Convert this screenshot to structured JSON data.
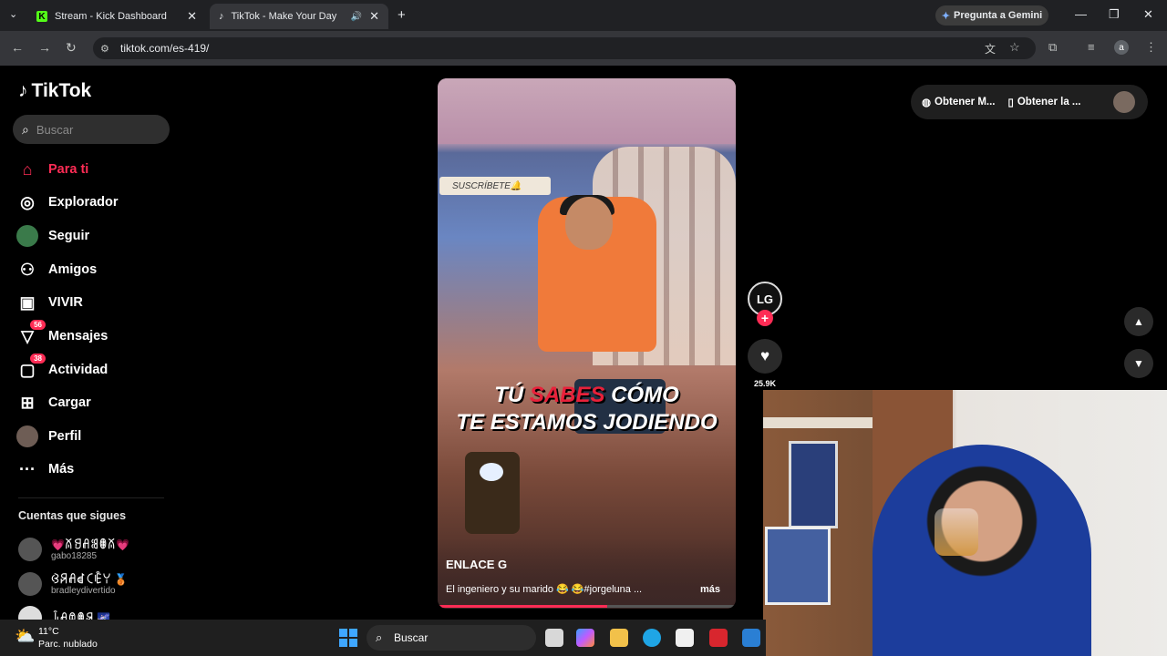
{
  "browser": {
    "tabs": [
      {
        "title": "Stream - Kick Dashboard",
        "favicon": "K"
      },
      {
        "title": "TikTok - Make Your Day",
        "favicon": "♪"
      }
    ],
    "url": "tiktok.com/es-419/",
    "gemini_label": "Pregunta a Gemini",
    "profile_initial": "a"
  },
  "tiktok": {
    "brand": "TikTok",
    "search_placeholder": "Buscar",
    "nav": [
      {
        "label": "Para ti"
      },
      {
        "label": "Explorador"
      },
      {
        "label": "Seguir"
      },
      {
        "label": "Amigos"
      },
      {
        "label": "VIVIR"
      },
      {
        "label": "Mensajes",
        "badge": "56"
      },
      {
        "label": "Actividad",
        "badge": "38"
      },
      {
        "label": "Cargar"
      },
      {
        "label": "Perfil"
      },
      {
        "label": "Más"
      }
    ],
    "following_title": "Cuentas que sigues",
    "following": [
      {
        "name": "💗ꊼꍌꋬꌃꂦꊼ💗",
        "user": "gabo18285"
      },
      {
        "name": "ꃳꋪꋬꀸꉔꍟꌩ 🥉",
        "user": "bradleydivertido"
      },
      {
        "name": "ꀭꋬꀧꂦꋪ 🌌",
        "user": ""
      }
    ],
    "top_right": {
      "item1": "Obtener M...",
      "item2": "Obtener la ..."
    },
    "video": {
      "sub_tag": "SUSCRÍBETE🔔",
      "caption_line1_a": "TÚ ",
      "caption_line1_b": "SABES",
      "caption_line1_c": " CÓMO",
      "caption_line2": "TE ESTAMOS JODIENDO",
      "author": "ENLACE G",
      "description": "El ingeniero y su marido 😂 😂#jorgeluna ...",
      "more": "más",
      "progress_fraction": 0.57
    },
    "creator_initials": "LG",
    "like_count": "25.9K"
  },
  "taskbar": {
    "temperature": "11°C",
    "condition": "Parc. nublado",
    "search": "Buscar"
  }
}
